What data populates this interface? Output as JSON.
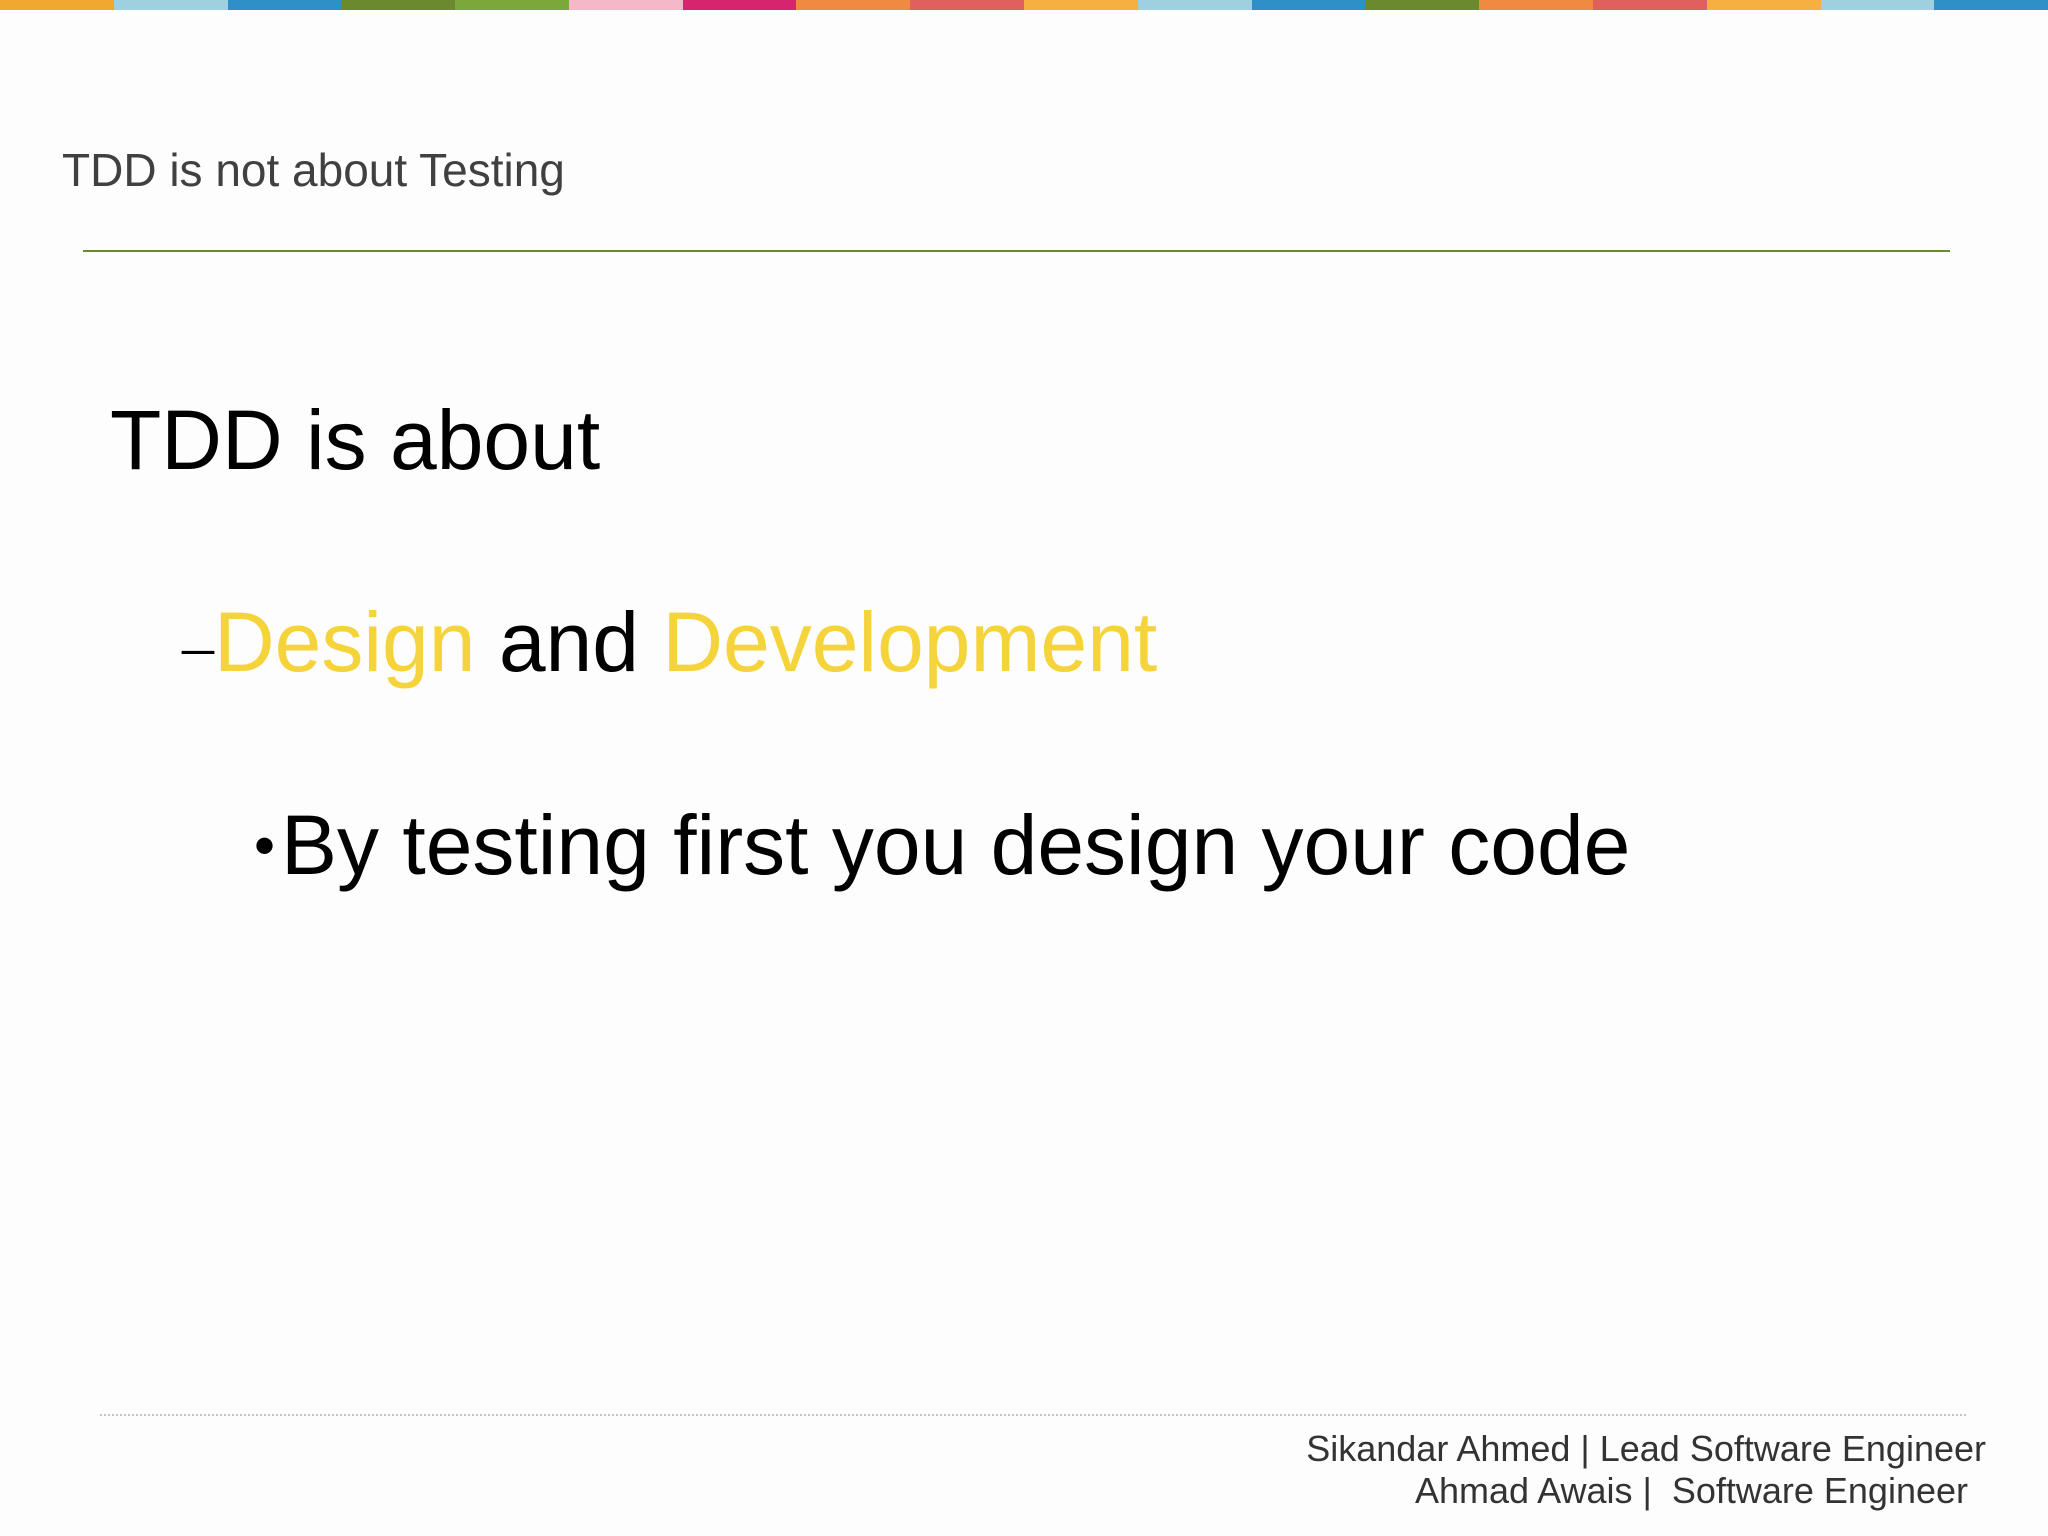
{
  "slide": {
    "title": "TDD is not about Testing",
    "heading": "TDD is about",
    "sub_point": {
      "dash": "–",
      "word1": "Design",
      "connector": " and ",
      "word2": "Development"
    },
    "bullet": {
      "marker": "•",
      "text": "By testing first you design your code"
    },
    "footer": {
      "line1": "Sikandar Ahmed | Lead Software Engineer",
      "line2": "Ahmad Awais |  Software Engineer"
    }
  },
  "colors": {
    "accent_yellow": "#f5d43b",
    "title_rule_green": "#6b8a2e",
    "top_bar": [
      "#f0a830",
      "#9fd0e0",
      "#2f8fc8",
      "#6b8a2e",
      "#7aa83a",
      "#f4b8c8",
      "#d6246e",
      "#f08a40",
      "#e06060",
      "#f5b040",
      "#9fd0e0",
      "#2f8fc8",
      "#6b8a2e",
      "#f08a40",
      "#e06060",
      "#f5b040",
      "#9fd0e0",
      "#2f8fc8"
    ]
  }
}
